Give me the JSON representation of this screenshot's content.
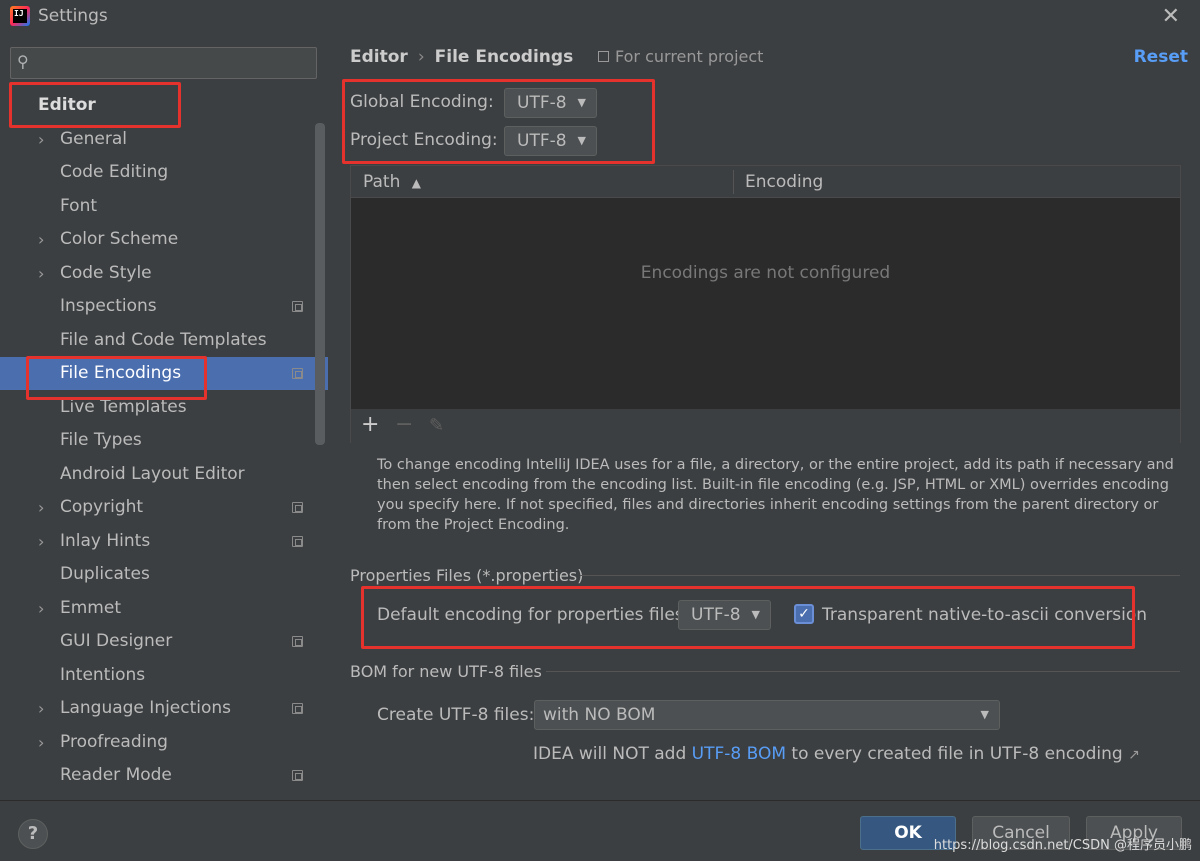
{
  "window": {
    "title": "Settings",
    "logo_text": "IJ"
  },
  "search": {
    "placeholder": ""
  },
  "sidebar": {
    "items": [
      {
        "label": "Editor",
        "type": "header"
      },
      {
        "label": "General",
        "expandable": true
      },
      {
        "label": "Code Editing"
      },
      {
        "label": "Font"
      },
      {
        "label": "Color Scheme",
        "expandable": true
      },
      {
        "label": "Code Style",
        "expandable": true
      },
      {
        "label": "Inspections",
        "project_icon": true
      },
      {
        "label": "File and Code Templates"
      },
      {
        "label": "File Encodings",
        "selected": true,
        "project_icon": true
      },
      {
        "label": "Live Templates"
      },
      {
        "label": "File Types"
      },
      {
        "label": "Android Layout Editor"
      },
      {
        "label": "Copyright",
        "expandable": true,
        "project_icon": true
      },
      {
        "label": "Inlay Hints",
        "expandable": true,
        "project_icon": true
      },
      {
        "label": "Duplicates"
      },
      {
        "label": "Emmet",
        "expandable": true
      },
      {
        "label": "GUI Designer",
        "project_icon": true
      },
      {
        "label": "Intentions"
      },
      {
        "label": "Language Injections",
        "expandable": true,
        "project_icon": true
      },
      {
        "label": "Proofreading",
        "expandable": true
      },
      {
        "label": "Reader Mode",
        "project_icon": true
      }
    ]
  },
  "header": {
    "breadcrumb_parent": "Editor",
    "breadcrumb_current": "File Encodings",
    "scope_note": "For current project",
    "reset_label": "Reset"
  },
  "encodings": {
    "global_label": "Global Encoding:",
    "global_value": "UTF-8",
    "project_label": "Project Encoding:",
    "project_value": "UTF-8"
  },
  "table": {
    "columns": [
      "Path",
      "Encoding"
    ],
    "sort_indicator": "▲",
    "empty_message": "Encodings are not configured"
  },
  "description": "To change encoding IntelliJ IDEA uses for a file, a directory, or the entire project, add its path if necessary and then select encoding from the encoding list. Built-in file encoding (e.g. JSP, HTML or XML) overrides encoding you specify here. If not specified, files and directories inherit encoding settings from the parent directory or from the Project Encoding.",
  "properties": {
    "section_title": "Properties Files (*.properties)",
    "default_label": "Default encoding for properties files:",
    "default_value": "UTF-8",
    "transparent_label": "Transparent native-to-ascii conversion",
    "transparent_checked": true
  },
  "bom": {
    "section_title": "BOM for new UTF-8 files",
    "create_label": "Create UTF-8 files:",
    "create_value": "with NO BOM",
    "hint_prefix": "IDEA will NOT add ",
    "hint_link": "UTF-8 BOM",
    "hint_suffix": " to every created file in UTF-8 encoding"
  },
  "footer": {
    "help_label": "?",
    "ok_label": "OK",
    "cancel_label": "Cancel",
    "apply_label": "Apply"
  },
  "watermark": "https://blog.csdn.net/CSDN @程序员小鹏"
}
